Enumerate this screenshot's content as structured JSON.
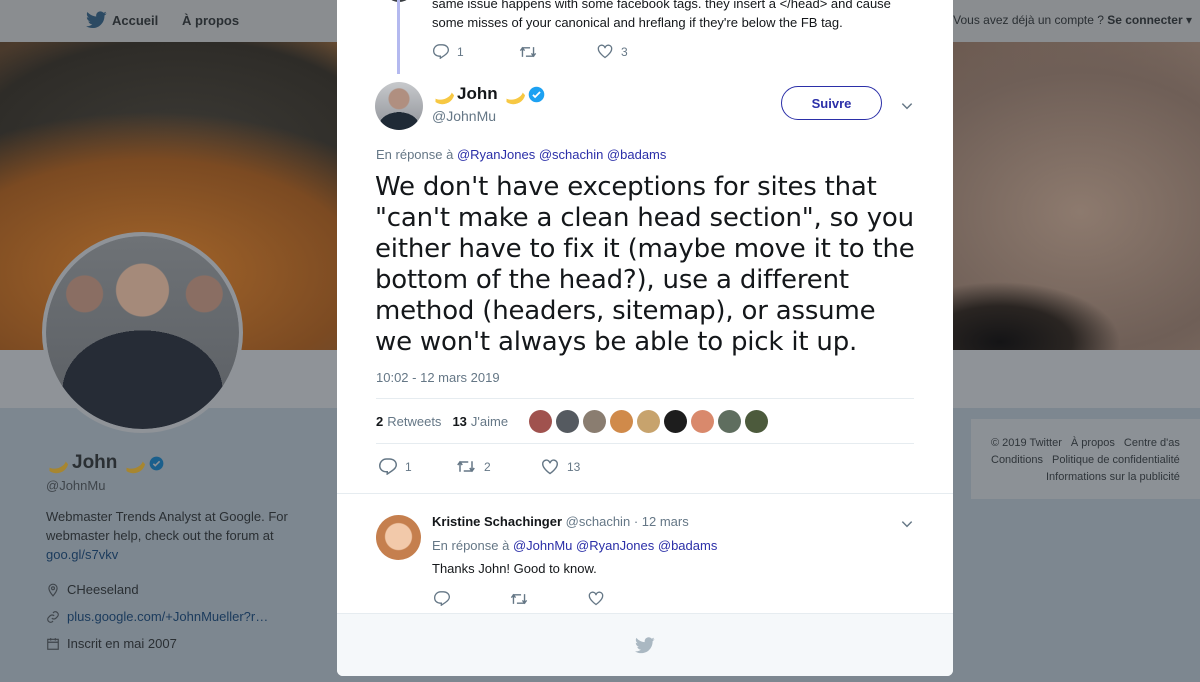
{
  "nav": {
    "home_label": "Accueil",
    "about_label": "À propos",
    "login_prompt": "Vous avez déjà un compte ?",
    "login_label": "Se connecter"
  },
  "profile": {
    "name": "John",
    "handle": "@JohnMu",
    "bio": "Webmaster Trends Analyst at Google. For webmaster help, check out the forum at",
    "bio_link": "goo.gl/s7vkv",
    "location": "CHeeseland",
    "website": "plus.google.com/+JohnMueller?r…",
    "joined": "Inscrit en mai 2007"
  },
  "footer": {
    "links": [
      "© 2019 Twitter",
      "À propos",
      "Centre d'as",
      "Conditions",
      "Politique de confidentialité",
      "Informations sur la publicité"
    ]
  },
  "previous_tweet": {
    "text_line1": "same issue happens with some facebook tags. they insert a </head> and cause",
    "text_line2": "some misses of your canonical and hreflang if they're below the FB tag.",
    "replies": "1",
    "retweets": "",
    "likes": "3"
  },
  "main_tweet": {
    "name": "John",
    "handle": "@JohnMu",
    "follow_label": "Suivre",
    "reply_prefix": "En réponse à",
    "reply_mentions": "@RyanJones @schachin @badams",
    "text": "We don't have exceptions for sites that \"can't make a clean head section\", so you either have to fix it (maybe move it to the bottom of the head?), use a different method (headers, sitemap), or assume we won't always be able to pick it up.",
    "timestamp": "10:02 - 12 mars 2019",
    "retweet_count": "2",
    "retweet_label": "Retweets",
    "like_count": "13",
    "like_label": "J'aime",
    "replies": "1",
    "retweets": "2",
    "likes": "13",
    "liker_colors": [
      "#a0524e",
      "#555a60",
      "#8a7d70",
      "#d08a4a",
      "#c7a36d",
      "#1d1d1d",
      "#d9896c",
      "#5f6e5f",
      "#4c5a3c"
    ]
  },
  "reply_tweet": {
    "name": "Kristine Schachinger",
    "handle": "@schachin",
    "date": "· 12 mars",
    "reply_prefix": "En réponse à",
    "reply_mentions": "@JohnMu @RyanJones @badams",
    "text": "Thanks John! Good to know."
  },
  "colors": {
    "accent": "#2b2fa8",
    "verified": "#1da1f2",
    "muted": "#657786",
    "thread_line": "#b4b9ef"
  }
}
